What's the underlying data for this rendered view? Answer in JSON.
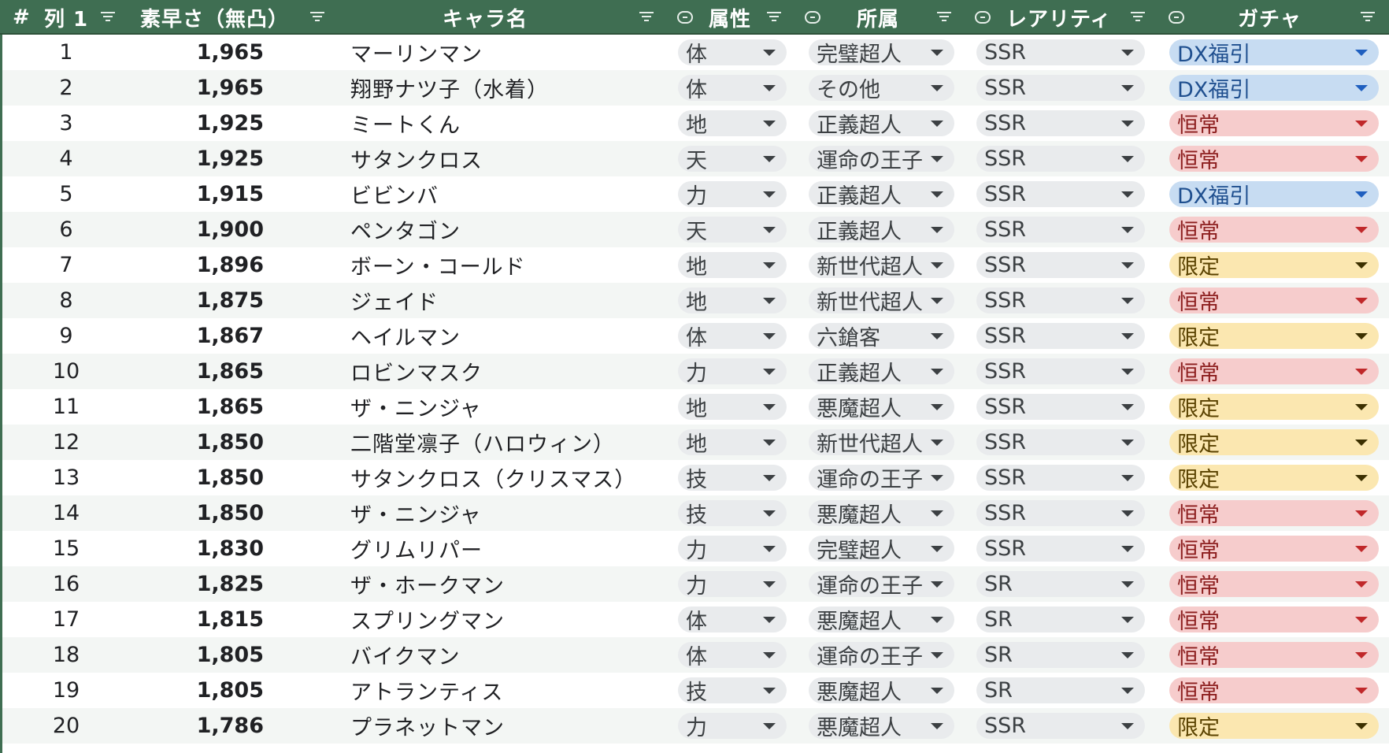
{
  "headers": {
    "hash": "#",
    "col1": "列 1",
    "speed": "素早さ（無凸）",
    "name": "キャラ名",
    "attr": "属性",
    "affiliation": "所属",
    "rarity": "レアリティ",
    "gacha": "ガチャ"
  },
  "colors": {
    "header_bg": "#3f6e52",
    "gacha_dx": "#c7dcf2",
    "gacha_normal": "#f6cccc",
    "gacha_limited": "#fbe7b0"
  },
  "rows": [
    {
      "num": "1",
      "speed": "1,965",
      "name": "マーリンマン",
      "attr": "体",
      "aff": "完璧超人",
      "rarity": "SSR",
      "gacha": "DX福引",
      "gacha_type": "dx"
    },
    {
      "num": "2",
      "speed": "1,965",
      "name": "翔野ナツ子（水着）",
      "attr": "体",
      "aff": "その他",
      "rarity": "SSR",
      "gacha": "DX福引",
      "gacha_type": "dx"
    },
    {
      "num": "3",
      "speed": "1,925",
      "name": "ミートくん",
      "attr": "地",
      "aff": "正義超人",
      "rarity": "SSR",
      "gacha": "恒常",
      "gacha_type": "normal"
    },
    {
      "num": "4",
      "speed": "1,925",
      "name": "サタンクロス",
      "attr": "天",
      "aff": "運命の王子",
      "rarity": "SSR",
      "gacha": "恒常",
      "gacha_type": "normal"
    },
    {
      "num": "5",
      "speed": "1,915",
      "name": "ビビンバ",
      "attr": "力",
      "aff": "正義超人",
      "rarity": "SSR",
      "gacha": "DX福引",
      "gacha_type": "dx"
    },
    {
      "num": "6",
      "speed": "1,900",
      "name": "ペンタゴン",
      "attr": "天",
      "aff": "正義超人",
      "rarity": "SSR",
      "gacha": "恒常",
      "gacha_type": "normal"
    },
    {
      "num": "7",
      "speed": "1,896",
      "name": "ボーン・コールド",
      "attr": "地",
      "aff": "新世代超人",
      "rarity": "SSR",
      "gacha": "限定",
      "gacha_type": "limited"
    },
    {
      "num": "8",
      "speed": "1,875",
      "name": "ジェイド",
      "attr": "地",
      "aff": "新世代超人",
      "rarity": "SSR",
      "gacha": "恒常",
      "gacha_type": "normal"
    },
    {
      "num": "9",
      "speed": "1,867",
      "name": "ヘイルマン",
      "attr": "体",
      "aff": "六鎗客",
      "rarity": "SSR",
      "gacha": "限定",
      "gacha_type": "limited"
    },
    {
      "num": "10",
      "speed": "1,865",
      "name": "ロビンマスク",
      "attr": "力",
      "aff": "正義超人",
      "rarity": "SSR",
      "gacha": "恒常",
      "gacha_type": "normal"
    },
    {
      "num": "11",
      "speed": "1,865",
      "name": "ザ・ニンジャ",
      "attr": "地",
      "aff": "悪魔超人",
      "rarity": "SSR",
      "gacha": "限定",
      "gacha_type": "limited"
    },
    {
      "num": "12",
      "speed": "1,850",
      "name": "二階堂凛子（ハロウィン）",
      "attr": "地",
      "aff": "新世代超人",
      "rarity": "SSR",
      "gacha": "限定",
      "gacha_type": "limited"
    },
    {
      "num": "13",
      "speed": "1,850",
      "name": "サタンクロス（クリスマス）",
      "attr": "技",
      "aff": "運命の王子",
      "rarity": "SSR",
      "gacha": "限定",
      "gacha_type": "limited"
    },
    {
      "num": "14",
      "speed": "1,850",
      "name": "ザ・ニンジャ",
      "attr": "技",
      "aff": "悪魔超人",
      "rarity": "SSR",
      "gacha": "恒常",
      "gacha_type": "normal"
    },
    {
      "num": "15",
      "speed": "1,830",
      "name": "グリムリパー",
      "attr": "力",
      "aff": "完璧超人",
      "rarity": "SSR",
      "gacha": "恒常",
      "gacha_type": "normal"
    },
    {
      "num": "16",
      "speed": "1,825",
      "name": "ザ・ホークマン",
      "attr": "力",
      "aff": "運命の王子",
      "rarity": "SR",
      "gacha": "恒常",
      "gacha_type": "normal"
    },
    {
      "num": "17",
      "speed": "1,815",
      "name": "スプリングマン",
      "attr": "体",
      "aff": "悪魔超人",
      "rarity": "SR",
      "gacha": "恒常",
      "gacha_type": "normal"
    },
    {
      "num": "18",
      "speed": "1,805",
      "name": "バイクマン",
      "attr": "体",
      "aff": "運命の王子",
      "rarity": "SR",
      "gacha": "恒常",
      "gacha_type": "normal"
    },
    {
      "num": "19",
      "speed": "1,805",
      "name": "アトランティス",
      "attr": "技",
      "aff": "悪魔超人",
      "rarity": "SR",
      "gacha": "恒常",
      "gacha_type": "normal"
    },
    {
      "num": "20",
      "speed": "1,786",
      "name": "プラネットマン",
      "attr": "力",
      "aff": "悪魔超人",
      "rarity": "SSR",
      "gacha": "限定",
      "gacha_type": "limited"
    }
  ]
}
